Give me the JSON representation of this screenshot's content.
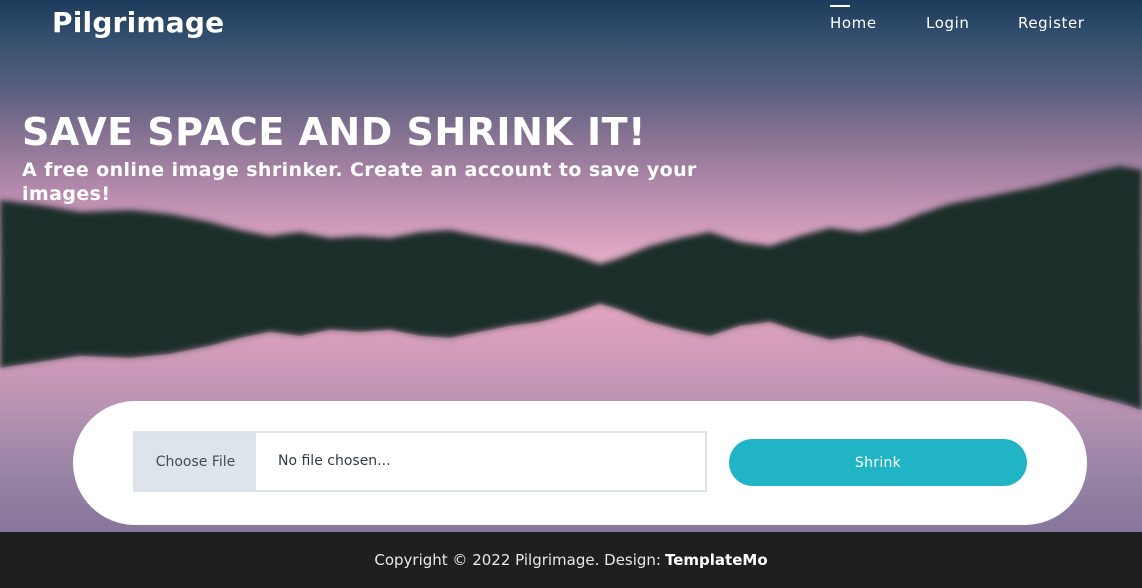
{
  "brand": {
    "title": "Pilgrimage"
  },
  "nav": {
    "items": [
      {
        "label": "Home",
        "active": true
      },
      {
        "label": "Login"
      },
      {
        "label": "Register"
      }
    ]
  },
  "hero": {
    "headline": "SAVE SPACE AND SHRINK IT!",
    "subtitle": "A free online image shrinker. Create an account to save your images!"
  },
  "upload": {
    "choose_label": "Choose File",
    "status": "No file chosen...",
    "submit_label": "Shrink"
  },
  "footer": {
    "copyright": "Copyright © 2022 Pilgrimage. Design:",
    "credit": "TemplateMo"
  },
  "colors": {
    "accent": "#21b4c4",
    "footer_bg": "#1f1f1f",
    "mountain": "#1c2e2b"
  }
}
